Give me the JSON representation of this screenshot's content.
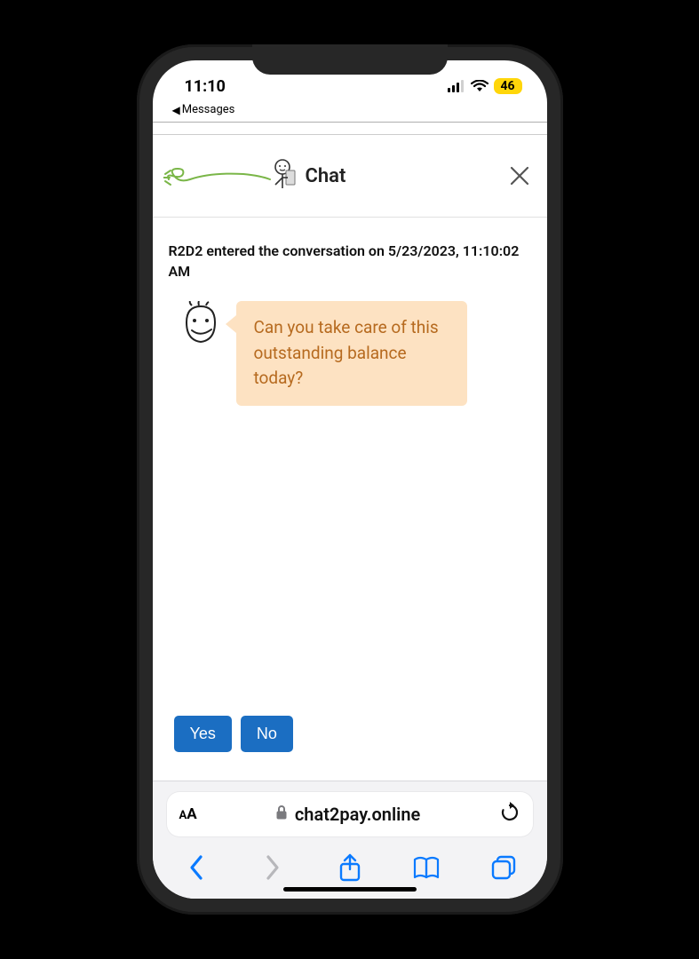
{
  "status": {
    "time": "11:10",
    "battery": "46",
    "back_label": "Messages"
  },
  "chat": {
    "title": "Chat",
    "system_message": "R2D2 entered the conversation on 5/23/2023, 11:10:02 AM",
    "bubble_text": "Can you take care of this outstanding balance today?",
    "yes_label": "Yes",
    "no_label": "No"
  },
  "browser": {
    "url": "chat2pay.online"
  }
}
